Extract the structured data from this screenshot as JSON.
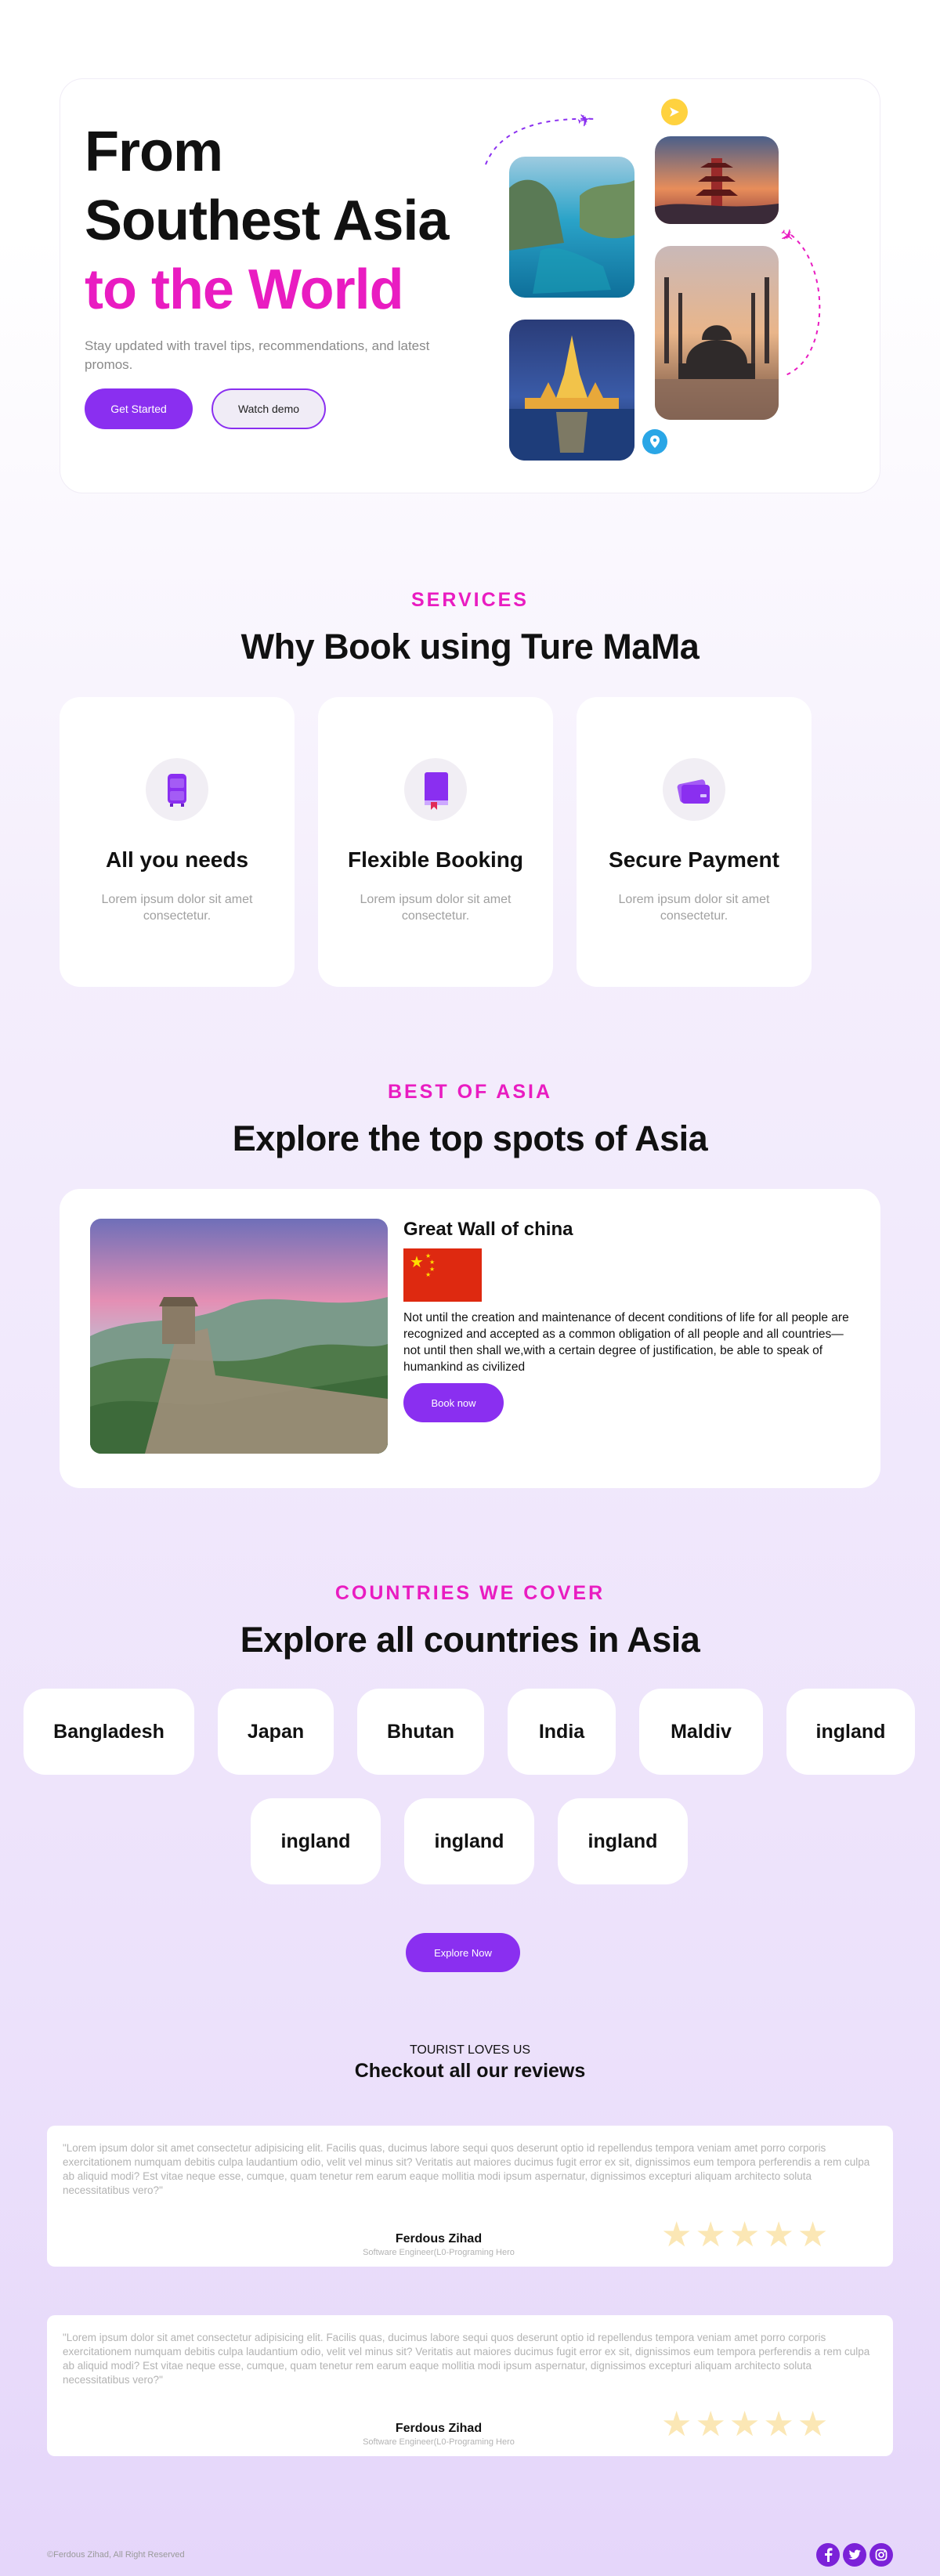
{
  "hero": {
    "title_line1": "From",
    "title_line2": "Southest Asia",
    "title_line3": "to the World",
    "subtitle": "Stay updated with travel tips, recommendations, and latest promos.",
    "get_started_label": "Get Started",
    "watch_demo_label": "Watch demo"
  },
  "services": {
    "eyebrow": "SERVICES",
    "title": "Why Book using Ture MaMa",
    "cards": [
      {
        "title": "All you needs",
        "desc": "Lorem ipsum dolor sit amet consectetur.",
        "icon": "luggage-icon"
      },
      {
        "title": "Flexible Booking",
        "desc": "Lorem ipsum dolor sit amet consectetur.",
        "icon": "book-icon"
      },
      {
        "title": "Secure Payment",
        "desc": "Lorem ipsum dolor sit amet consectetur.",
        "icon": "card-icon"
      }
    ]
  },
  "spots": {
    "eyebrow": "BEST OF ASIA",
    "title": "Explore the top spots of Asia",
    "spot_title": "Great Wall of china",
    "spot_desc": "Not until the creation and maintenance of decent conditions of life for all people are recognized and accepted as a common obligation of all people and all countries—not until then shall we,with a certain degree of justification, be able to speak of humankind as civilized",
    "book_label": "Book now"
  },
  "countries": {
    "eyebrow": "COUNTRIES WE COVER",
    "title": "Explore all countries in Asia",
    "items": [
      "Bangladesh",
      "Japan",
      "Bhutan",
      "India",
      "Maldiv",
      "ingland",
      "ingland",
      "ingland",
      "ingland"
    ],
    "explore_label": "Explore Now"
  },
  "reviews": {
    "eyebrow": "TOURIST LOVES US",
    "title": "Checkout all our reviews",
    "items": [
      {
        "text": "\"Lorem ipsum dolor sit amet consectetur adipisicing elit. Facilis quas, ducimus labore sequi quos deserunt optio id repellendus tempora veniam amet porro corporis exercitationem numquam debitis culpa laudantium odio, velit vel minus sit? Veritatis aut maiores ducimus fugit error ex sit, dignissimos eum tempora perferendis a rem culpa ab aliquid modi? Est vitae neque esse, cumque, quam tenetur rem earum eaque mollitia modi ipsum aspernatur, dignissimos excepturi aliquam architecto soluta necessitatibus vero?\"",
        "name": "Ferdous Zihad",
        "role": "Software Engineer(L0-Programing Hero",
        "rating": 5
      },
      {
        "text": "\"Lorem ipsum dolor sit amet consectetur adipisicing elit. Facilis quas, ducimus labore sequi quos deserunt optio id repellendus tempora veniam amet porro corporis exercitationem numquam debitis culpa laudantium odio, velit vel minus sit? Veritatis aut maiores ducimus fugit error ex sit, dignissimos eum tempora perferendis a rem culpa ab aliquid modi? Est vitae neque esse, cumque, quam tenetur rem earum eaque mollitia modi ipsum aspernatur, dignissimos excepturi aliquam architecto soluta necessitatibus vero?\"",
        "name": "Ferdous Zihad",
        "role": "Software Engineer(L0-Programing Hero",
        "rating": 5
      }
    ]
  },
  "footer": {
    "copyright": "©Ferdous Zihad, All Right Reserved",
    "social_icons": [
      "facebook-icon",
      "twitter-icon",
      "instagram-icon"
    ]
  },
  "colors": {
    "accent": "#8a2ff0",
    "pink": "#e91cc1",
    "star": "#fbe7b5"
  }
}
